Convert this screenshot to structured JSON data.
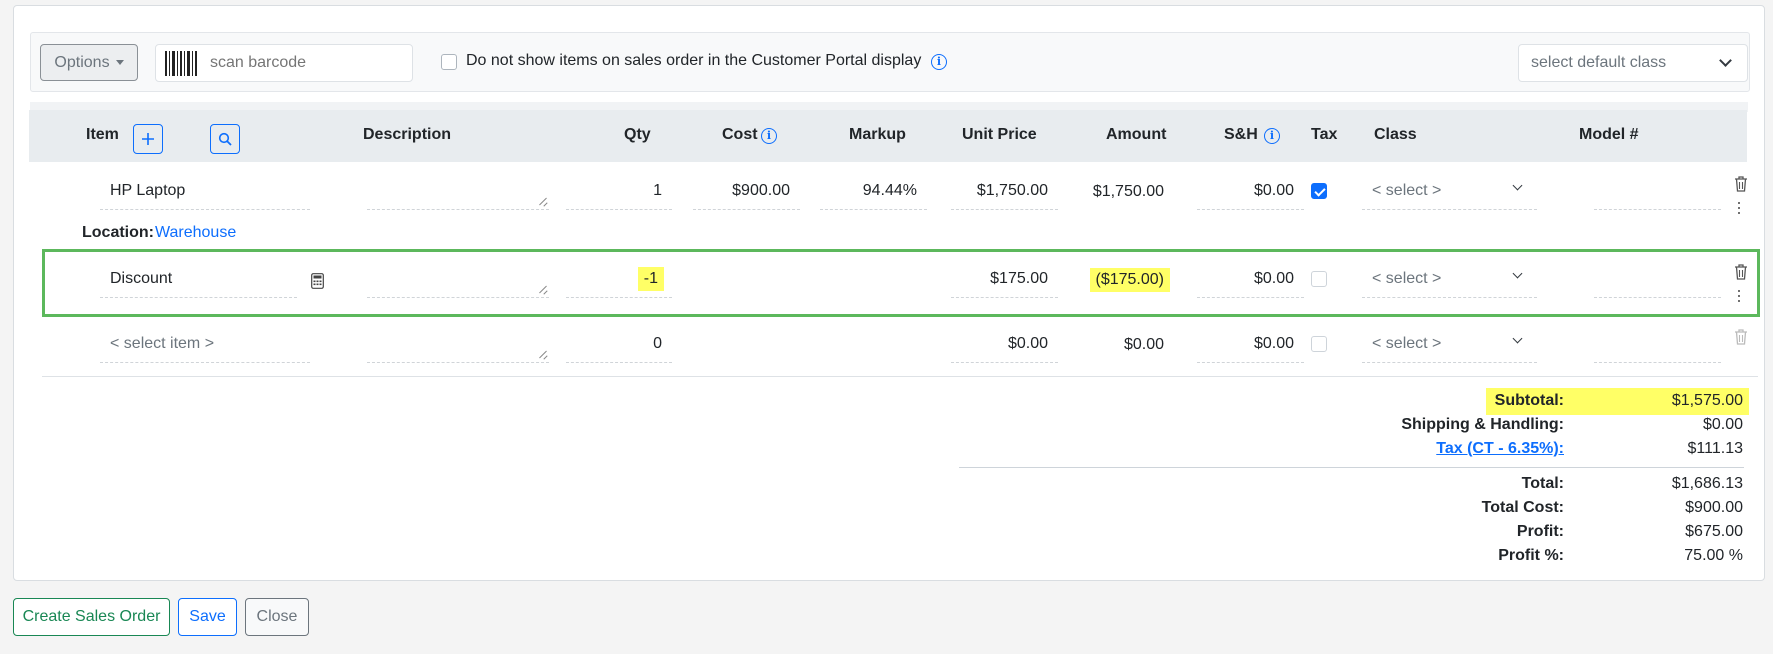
{
  "toolbar": {
    "options_label": "Options",
    "barcode_placeholder": "scan barcode",
    "portal_label": "Do not show items on sales order in the Customer Portal display",
    "default_class_placeholder": "select default class"
  },
  "columns": {
    "item": "Item",
    "description": "Description",
    "qty": "Qty",
    "cost": "Cost",
    "markup": "Markup",
    "unit_price": "Unit Price",
    "amount": "Amount",
    "sh": "S&H",
    "tax": "Tax",
    "class": "Class",
    "model": "Model #"
  },
  "rows": [
    {
      "item": "HP Laptop",
      "qty": "1",
      "cost": "$900.00",
      "markup": "94.44%",
      "unit_price": "$1,750.00",
      "amount": "$1,750.00",
      "sh": "$0.00",
      "tax_checked": true,
      "class": "< select >"
    },
    {
      "item": "Discount",
      "qty": "-1",
      "cost": "",
      "markup": "",
      "unit_price": "$175.00",
      "amount": "($175.00)",
      "sh": "$0.00",
      "tax_checked": false,
      "class": "< select >"
    },
    {
      "item": "< select item >",
      "qty": "0",
      "cost": "",
      "markup": "",
      "unit_price": "$0.00",
      "amount": "$0.00",
      "sh": "$0.00",
      "tax_checked": false,
      "class": "< select >"
    }
  ],
  "location": {
    "label": "Location:",
    "value": "Warehouse"
  },
  "totals": {
    "subtotal_label": "Subtotal:",
    "subtotal": "$1,575.00",
    "shipping_label": "Shipping & Handling:",
    "shipping": "$0.00",
    "tax_label": "Tax (CT - 6.35%):",
    "tax": "$111.13",
    "total_label": "Total:",
    "total": "$1,686.13",
    "total_cost_label": "Total Cost:",
    "total_cost": "$900.00",
    "profit_label": "Profit:",
    "profit": "$675.00",
    "profit_pct_label": "Profit %:",
    "profit_pct": "75.00 %"
  },
  "footer": {
    "create_label": "Create Sales Order",
    "save_label": "Save",
    "close_label": "Close"
  },
  "colors": {
    "primary": "#0d6efd",
    "success": "#198754",
    "highlight": "#ffff66",
    "selection_border": "#5cb85c"
  }
}
